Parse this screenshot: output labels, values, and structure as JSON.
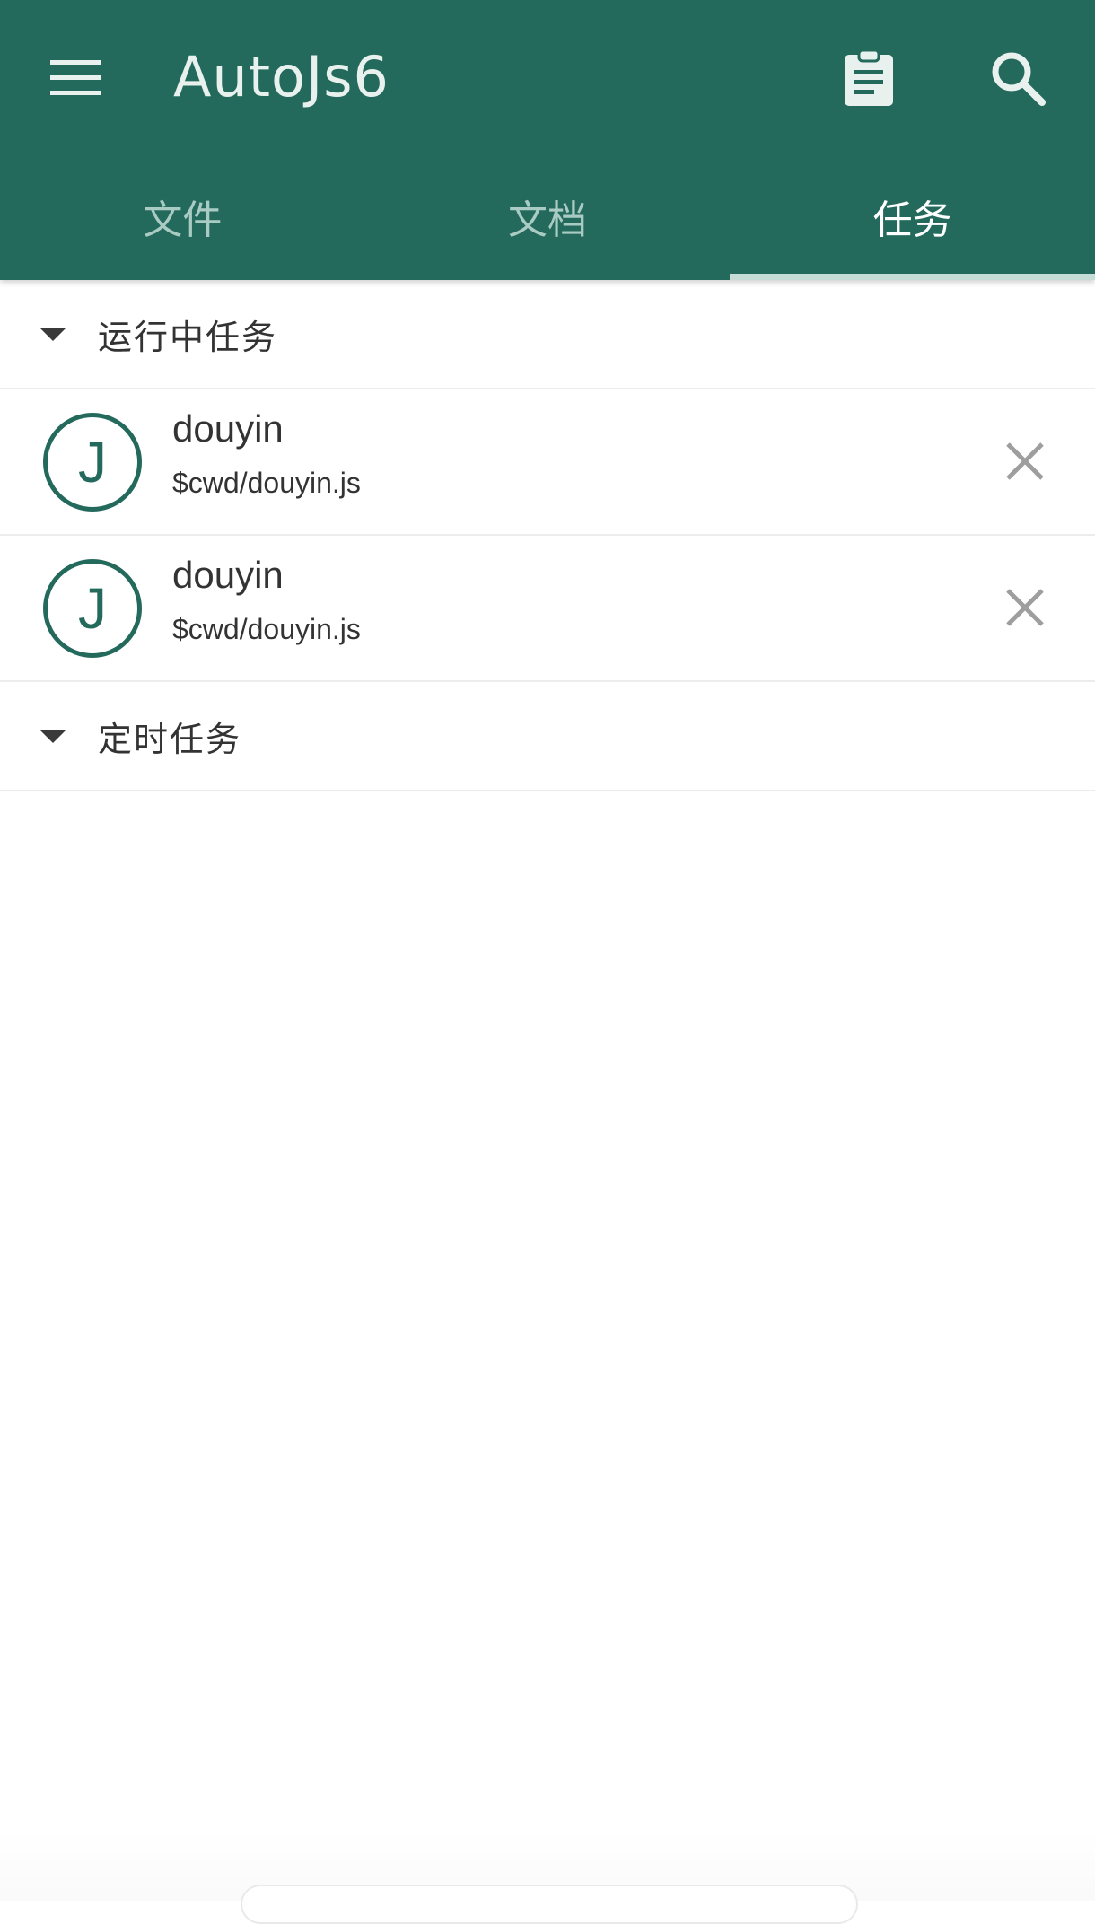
{
  "app": {
    "title": "AutoJs6",
    "colors": {
      "primary": "#246a5c",
      "tab_active": "#ffffff",
      "tab_inactive": "#a9cbc4",
      "indicator": "#c6dcd7",
      "text": "#333333",
      "close_icon": "#9e9e9e"
    }
  },
  "toolbar": {
    "menu_icon": "hamburger-menu-icon",
    "clipboard_icon": "clipboard-icon",
    "search_icon": "search-icon"
  },
  "tabs": [
    {
      "label": "文件",
      "active": false
    },
    {
      "label": "文档",
      "active": false
    },
    {
      "label": "任务",
      "active": true
    }
  ],
  "groups": {
    "running": {
      "label": "运行中任务",
      "items": [
        {
          "avatar_letter": "J",
          "name": "douyin",
          "path": "$cwd/douyin.js"
        },
        {
          "avatar_letter": "J",
          "name": "douyin",
          "path": "$cwd/douyin.js"
        }
      ]
    },
    "scheduled": {
      "label": "定时任务",
      "items": []
    }
  }
}
